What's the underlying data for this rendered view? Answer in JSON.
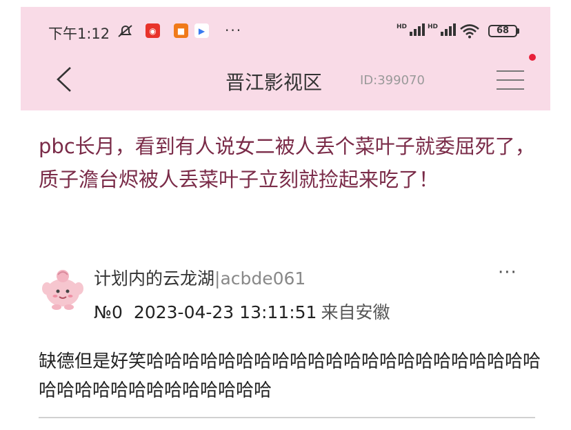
{
  "status_bar": {
    "time": "下午1:12",
    "overflow": "···",
    "signal_1_label": "HD",
    "signal_2_label": "HD",
    "battery": "68"
  },
  "header": {
    "title": "晋江影视区",
    "forum_id": "ID:399070",
    "accent": "#f9dbe7"
  },
  "post": {
    "title": "pbc长月，看到有人说女二被人丢个菜叶子就委屈死了，质子澹台烬被人丢菜叶子立刻就捡起来吃了！"
  },
  "reply": {
    "author_name": "计划内的云龙湖",
    "author_id": "|acbde061",
    "floor": "№0",
    "datetime": "2023-04-23 13:11:51",
    "location": "来自安徽",
    "more": "···",
    "content": "缺德但是好笑哈哈哈哈哈哈哈哈哈哈哈哈哈哈哈哈哈哈哈哈哈哈哈哈哈哈哈哈哈哈哈哈哈哈哈"
  }
}
